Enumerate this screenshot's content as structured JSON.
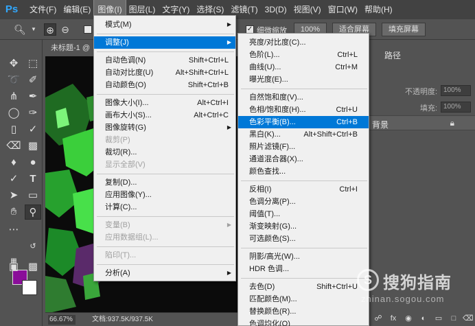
{
  "app": {
    "logo": "Ps",
    "menubar": [
      "文件(F)",
      "编辑(E)",
      "图像(I)",
      "图层(L)",
      "文字(Y)",
      "选择(S)",
      "滤镜(T)",
      "3D(D)",
      "视图(V)",
      "窗口(W)",
      "帮助(H)"
    ],
    "active_menu": "图像(I)"
  },
  "options_bar": {
    "scroll_all_label": "细微缩放",
    "zoom_value": "100%",
    "fit_screen_label": "适合屏幕",
    "fill_screen_label": "填充屏幕"
  },
  "document": {
    "tab_title": "未标题-1 @",
    "zoom": "66.67%",
    "doc_info": "文档:937.5K/937.5K"
  },
  "colors": {
    "foreground": "#8a0e99",
    "background": "#ffffff",
    "menu_highlight": "#0078d7"
  },
  "image_menu": {
    "items": [
      {
        "label": "模式(M)",
        "shortcut": "",
        "submenu": true,
        "disabled": false
      },
      {
        "label": "调整(J)",
        "shortcut": "",
        "submenu": true,
        "disabled": false,
        "highlighted": true
      },
      {
        "label": "自动色调(N)",
        "shortcut": "Shift+Ctrl+L",
        "disabled": false
      },
      {
        "label": "自动对比度(U)",
        "shortcut": "Alt+Shift+Ctrl+L",
        "disabled": false
      },
      {
        "label": "自动颜色(O)",
        "shortcut": "Shift+Ctrl+B",
        "disabled": false
      },
      {
        "label": "图像大小(I)...",
        "shortcut": "Alt+Ctrl+I",
        "disabled": false
      },
      {
        "label": "画布大小(S)...",
        "shortcut": "Alt+Ctrl+C",
        "disabled": false
      },
      {
        "label": "图像旋转(G)",
        "shortcut": "",
        "submenu": true,
        "disabled": false
      },
      {
        "label": "裁剪(P)",
        "shortcut": "",
        "disabled": true
      },
      {
        "label": "裁切(R)...",
        "shortcut": "",
        "disabled": false
      },
      {
        "label": "显示全部(V)",
        "shortcut": "",
        "disabled": true
      },
      {
        "label": "复制(D)...",
        "shortcut": "",
        "disabled": false
      },
      {
        "label": "应用图像(Y)...",
        "shortcut": "",
        "disabled": false
      },
      {
        "label": "计算(C)...",
        "shortcut": "",
        "disabled": false
      },
      {
        "label": "变量(B)",
        "shortcut": "",
        "submenu": true,
        "disabled": true
      },
      {
        "label": "应用数据组(L)...",
        "shortcut": "",
        "disabled": true
      },
      {
        "label": "陷印(T)...",
        "shortcut": "",
        "disabled": true
      },
      {
        "label": "分析(A)",
        "shortcut": "",
        "submenu": true,
        "disabled": false
      }
    ]
  },
  "adjust_submenu": {
    "items": [
      {
        "label": "亮度/对比度(C)...",
        "shortcut": ""
      },
      {
        "label": "色阶(L)...",
        "shortcut": "Ctrl+L"
      },
      {
        "label": "曲线(U)...",
        "shortcut": "Ctrl+M"
      },
      {
        "label": "曝光度(E)...",
        "shortcut": ""
      },
      {
        "label": "自然饱和度(V)...",
        "shortcut": ""
      },
      {
        "label": "色相/饱和度(H)...",
        "shortcut": "Ctrl+U"
      },
      {
        "label": "色彩平衡(B)...",
        "shortcut": "Ctrl+B",
        "highlighted": true
      },
      {
        "label": "黑白(K)...",
        "shortcut": "Alt+Shift+Ctrl+B"
      },
      {
        "label": "照片滤镜(F)...",
        "shortcut": ""
      },
      {
        "label": "通道混合器(X)...",
        "shortcut": ""
      },
      {
        "label": "颜色查找...",
        "shortcut": ""
      },
      {
        "label": "反相(I)",
        "shortcut": "Ctrl+I"
      },
      {
        "label": "色调分离(P)...",
        "shortcut": ""
      },
      {
        "label": "阈值(T)...",
        "shortcut": ""
      },
      {
        "label": "渐变映射(G)...",
        "shortcut": ""
      },
      {
        "label": "可选颜色(S)...",
        "shortcut": ""
      },
      {
        "label": "阴影/高光(W)...",
        "shortcut": ""
      },
      {
        "label": "HDR 色调...",
        "shortcut": ""
      },
      {
        "label": "去色(D)",
        "shortcut": "Shift+Ctrl+U"
      },
      {
        "label": "匹配颜色(M)...",
        "shortcut": ""
      },
      {
        "label": "替换颜色(R)...",
        "shortcut": ""
      },
      {
        "label": "色调均化(Q)",
        "shortcut": ""
      }
    ]
  },
  "panels": {
    "tab_paths": "路径",
    "opacity_label": "不透明度:",
    "opacity_value": "100%",
    "fill_label": "填充:",
    "fill_value": "100%",
    "layer_name": "背景"
  },
  "watermark": {
    "glyph": "S",
    "brand": "搜狗指南",
    "url": "zhinan.sogou.com"
  }
}
